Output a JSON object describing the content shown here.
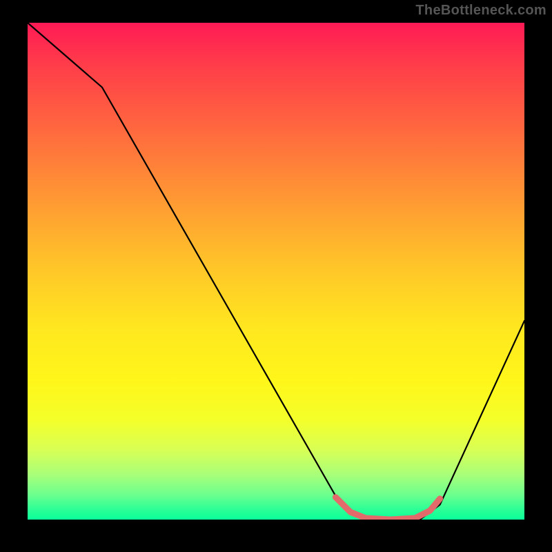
{
  "watermark": "TheBottleneck.com",
  "chart_data": {
    "type": "line",
    "title": "",
    "xlabel": "",
    "ylabel": "",
    "xlim": [
      0,
      100
    ],
    "ylim": [
      0,
      100
    ],
    "series": [
      {
        "name": "curve",
        "color": "#000000",
        "x": [
          0,
          15,
          63,
          68,
          79,
          83,
          100
        ],
        "y": [
          100,
          87,
          3,
          0,
          0,
          3,
          40
        ]
      },
      {
        "name": "highlight",
        "color": "#e26a6a",
        "x": [
          62,
          65,
          68,
          73,
          78,
          81,
          83
        ],
        "y": [
          4.5,
          1.5,
          0.3,
          0,
          0.3,
          1.8,
          4.2
        ]
      }
    ],
    "gradient_stops": [
      {
        "pos": 0.0,
        "color": "#ff1a55"
      },
      {
        "pos": 0.08,
        "color": "#ff3b4a"
      },
      {
        "pos": 0.22,
        "color": "#ff6a3e"
      },
      {
        "pos": 0.36,
        "color": "#ff9a33"
      },
      {
        "pos": 0.5,
        "color": "#ffc828"
      },
      {
        "pos": 0.62,
        "color": "#ffe81f"
      },
      {
        "pos": 0.72,
        "color": "#fff61a"
      },
      {
        "pos": 0.8,
        "color": "#f4ff2a"
      },
      {
        "pos": 0.86,
        "color": "#d8ff55"
      },
      {
        "pos": 0.91,
        "color": "#a8ff7a"
      },
      {
        "pos": 0.95,
        "color": "#6cff8e"
      },
      {
        "pos": 0.98,
        "color": "#2bff96"
      },
      {
        "pos": 1.0,
        "color": "#0aff9a"
      }
    ]
  }
}
